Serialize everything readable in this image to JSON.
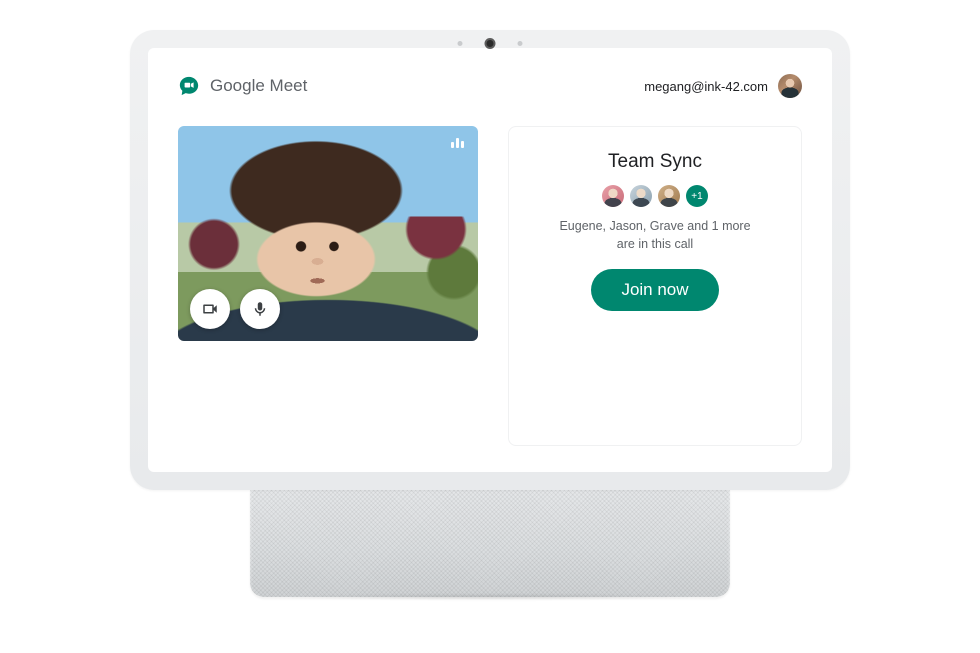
{
  "header": {
    "app_name": "Google Meet",
    "account_email": "megang@ink-42.com"
  },
  "meeting": {
    "title": "Team Sync",
    "participants_line1": "Eugene, Jason, Grave and 1 more",
    "participants_line2": "are in this call",
    "overflow_label": "+1",
    "join_label": "Join now"
  },
  "colors": {
    "accent": "#00876f"
  }
}
